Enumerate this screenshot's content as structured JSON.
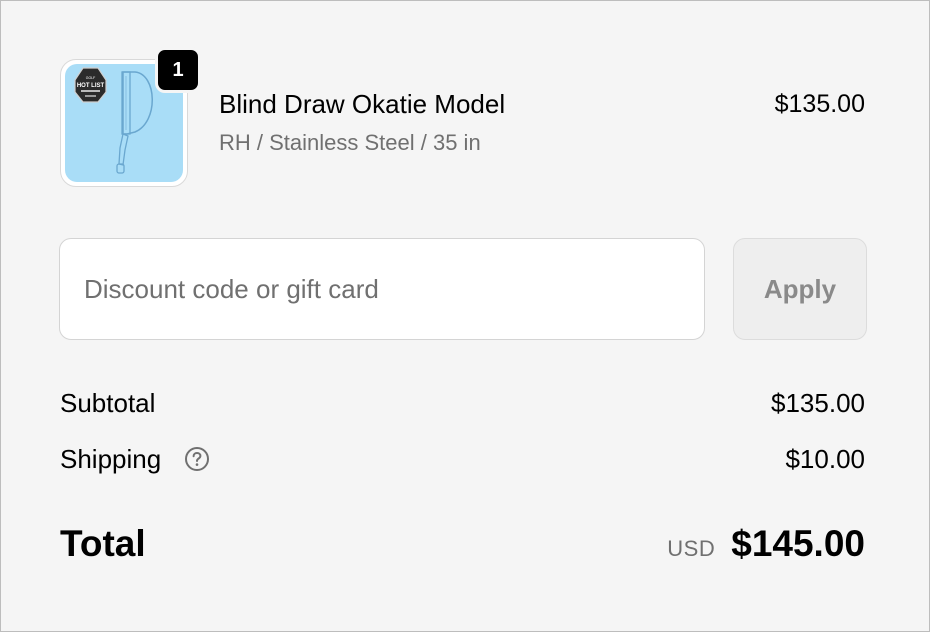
{
  "product": {
    "name": "Blind Draw Okatie Model",
    "variant": "RH / Stainless Steel / 35 in",
    "price": "$135.00",
    "quantity": "1",
    "image_badge_text": "HOT LIST"
  },
  "discount": {
    "placeholder": "Discount code or gift card",
    "value": "",
    "apply_label": "Apply"
  },
  "summary": {
    "subtotal_label": "Subtotal",
    "subtotal_value": "$135.00",
    "shipping_label": "Shipping",
    "shipping_value": "$10.00",
    "total_label": "Total",
    "currency": "USD",
    "total_value": "$145.00"
  },
  "colors": {
    "background": "#f5f5f5",
    "thumbnail_bg": "#a9ddf7",
    "badge": "#000000",
    "muted_text": "#707070"
  },
  "icons": {
    "shipping_help": "question-circle-icon"
  }
}
